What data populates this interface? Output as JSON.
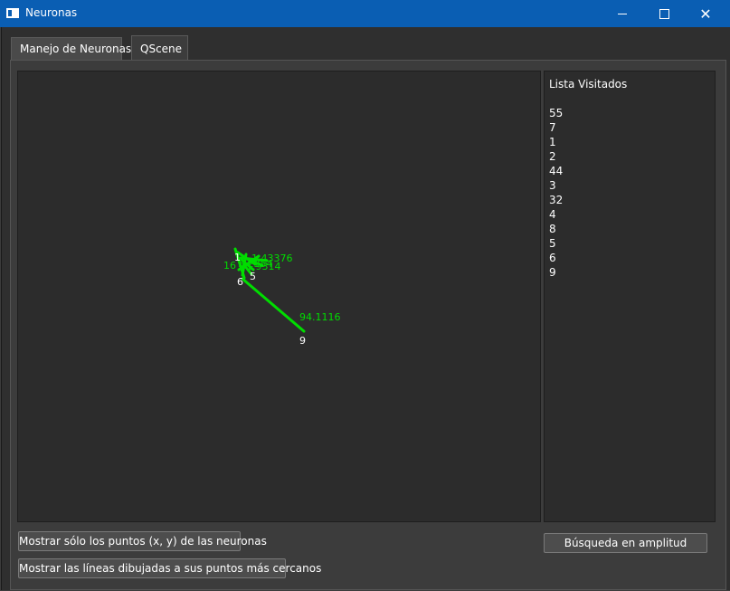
{
  "window": {
    "title": "Neuronas",
    "minimize": "—",
    "maximize": "☐",
    "close": "✕",
    "titlebar_color": "#0a5eb3"
  },
  "tabs": [
    {
      "label": "Manejo de Neuronas",
      "active": false
    },
    {
      "label": "QScene",
      "active": true
    }
  ],
  "scene": {
    "background": "#2c2c2c",
    "edge_color": "#00dd00",
    "labels": [
      {
        "text": "94.1116",
        "color": "#00dd00"
      },
      {
        "text": "9",
        "color": "#ffffff"
      },
      {
        "text": "6",
        "color": "#ffffff"
      },
      {
        "text": "5",
        "color": "#ffffff"
      },
      {
        "text": "16",
        "color": "#00dd00"
      },
      {
        "text": "1",
        "color": "#ffffff"
      }
    ]
  },
  "visited": {
    "heading": "Lista Visitados",
    "items": [
      "55",
      "7",
      "1",
      "2",
      "44",
      "3",
      "32",
      "4",
      "8",
      "5",
      "6",
      "9"
    ]
  },
  "buttons": {
    "show_points": "Mostrar sólo los puntos (x, y) de las neuronas",
    "show_lines": "Mostrar las líneas dibujadas a sus puntos más cercanos",
    "bfs": "Búsqueda en amplitud"
  }
}
